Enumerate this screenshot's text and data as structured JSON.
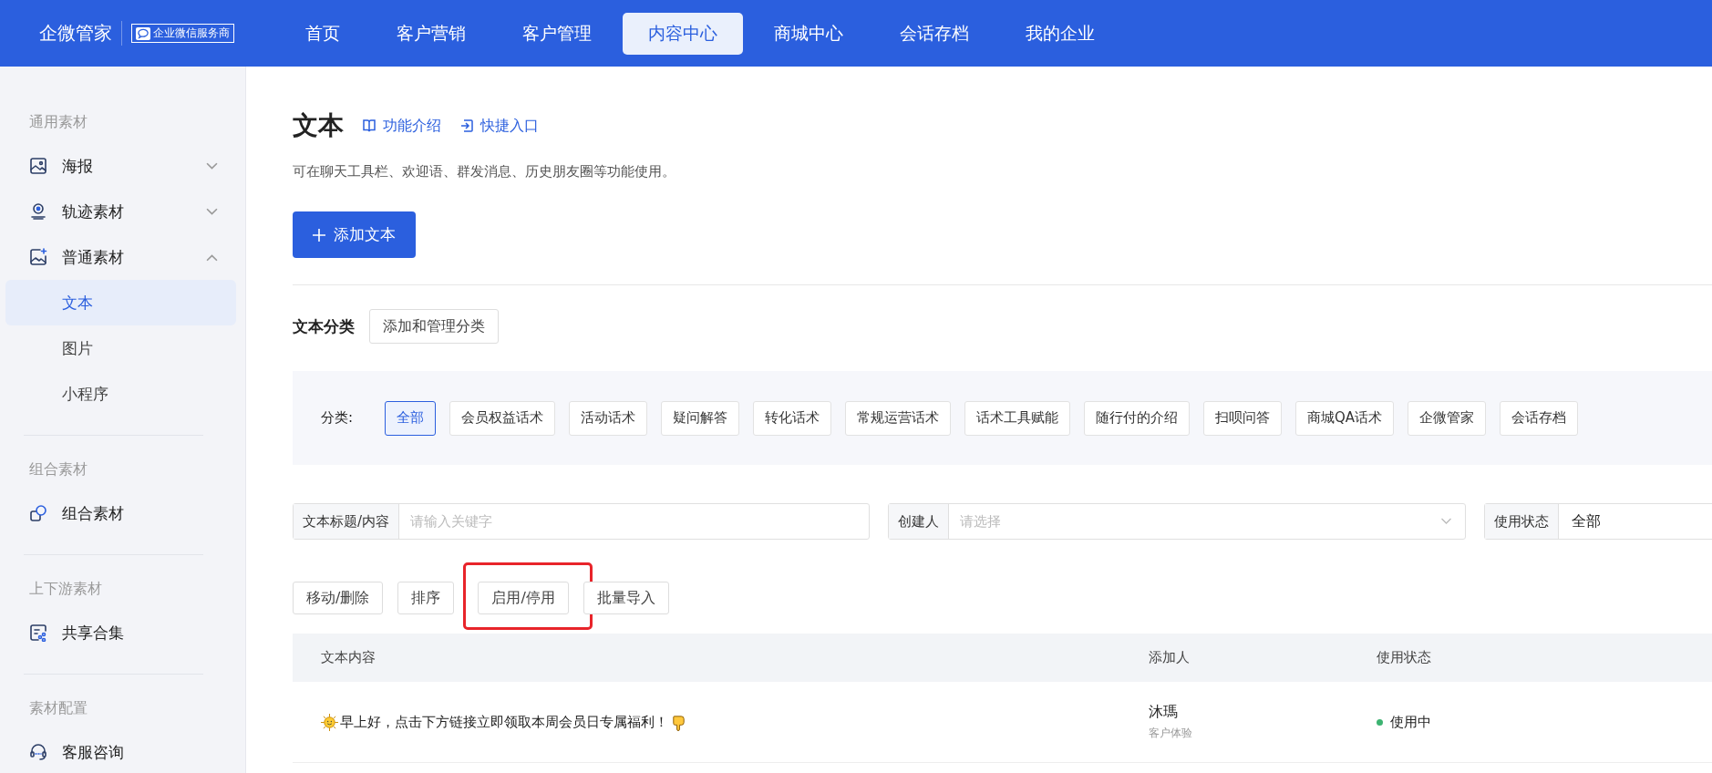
{
  "header": {
    "logo": "企微管家",
    "badge": "企业微信服务商",
    "nav": [
      {
        "label": "首页",
        "selected": false
      },
      {
        "label": "客户营销",
        "selected": false
      },
      {
        "label": "客户管理",
        "selected": false
      },
      {
        "label": "内容中心",
        "selected": true
      },
      {
        "label": "商城中心",
        "selected": false
      },
      {
        "label": "会话存档",
        "selected": false
      },
      {
        "label": "我的企业",
        "selected": false
      }
    ]
  },
  "sidebar": {
    "groups": [
      {
        "title": "通用素材",
        "items": [
          {
            "label": "海报",
            "expanded": false
          },
          {
            "label": "轨迹素材",
            "expanded": false
          },
          {
            "label": "普通素材",
            "expanded": true,
            "children": [
              {
                "label": "文本",
                "selected": true
              },
              {
                "label": "图片",
                "selected": false
              },
              {
                "label": "小程序",
                "selected": false
              }
            ]
          }
        ]
      },
      {
        "title": "组合素材",
        "items": [
          {
            "label": "组合素材"
          }
        ]
      },
      {
        "title": "上下游素材",
        "items": [
          {
            "label": "共享合集"
          }
        ]
      },
      {
        "title": "素材配置",
        "items": [
          {
            "label": "客服咨询"
          }
        ]
      }
    ]
  },
  "page": {
    "title": "文本",
    "links": [
      "功能介绍",
      "快捷入口"
    ],
    "description": "可在聊天工具栏、欢迎语、群发消息、历史朋友圈等功能使用。",
    "add_button": "添加文本"
  },
  "categories": {
    "title": "文本分类",
    "manage_button": "添加和管理分类",
    "label": "分类:",
    "items": [
      {
        "label": "全部",
        "selected": true
      },
      {
        "label": "会员权益话术",
        "selected": false
      },
      {
        "label": "活动话术",
        "selected": false
      },
      {
        "label": "疑问解答",
        "selected": false
      },
      {
        "label": "转化话术",
        "selected": false
      },
      {
        "label": "常规运营话术",
        "selected": false
      },
      {
        "label": "话术工具赋能",
        "selected": false
      },
      {
        "label": "随行付的介绍",
        "selected": false
      },
      {
        "label": "扫呗问答",
        "selected": false
      },
      {
        "label": "商城QA话术",
        "selected": false
      },
      {
        "label": "企微管家",
        "selected": false
      },
      {
        "label": "会话存档",
        "selected": false
      }
    ]
  },
  "filters": [
    {
      "kind": "text",
      "label": "文本标题/内容",
      "placeholder": "请输入关键字"
    },
    {
      "kind": "select",
      "label": "创建人",
      "placeholder": "请选择"
    },
    {
      "kind": "value",
      "label": "使用状态",
      "value": "全部"
    }
  ],
  "actions": [
    {
      "label": "移动/删除",
      "highlighted": false
    },
    {
      "label": "排序",
      "highlighted": false
    },
    {
      "label": "启用/停用",
      "highlighted": true
    },
    {
      "label": "批量导入",
      "highlighted": false
    }
  ],
  "table": {
    "columns": [
      "文本内容",
      "添加人",
      "使用状态"
    ],
    "rows": [
      {
        "content": "早上好，点击下方链接立即领取本周会员日专属福利！",
        "creator": "沐瑪",
        "creator_team": "客户体验",
        "status": "使用中",
        "color": "#3cb371"
      }
    ]
  }
}
